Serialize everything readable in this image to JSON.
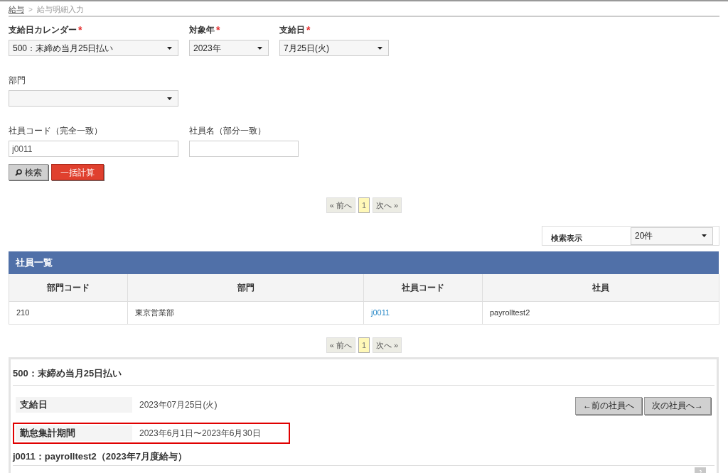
{
  "breadcrumb": {
    "items": [
      {
        "label": "給与",
        "kind": "link"
      },
      {
        "label": "給与明細入力",
        "kind": "current"
      }
    ],
    "separator": ">"
  },
  "filter_rows": [
    {
      "fields": [
        {
          "label": "支給日カレンダー",
          "required_mark": "*",
          "kind": "select",
          "value": "500：末締め当月25日払い"
        },
        {
          "label": "対象年",
          "required_mark": "*",
          "kind": "select",
          "value": "2023年"
        },
        {
          "label": "支給日",
          "required_mark": "*",
          "kind": "select",
          "value": "7月25日(火)"
        }
      ]
    },
    {
      "fields": [
        {
          "label": "部門",
          "kind": "select"
        }
      ]
    },
    {
      "fields": [
        {
          "label": "社員コード（完全一致）",
          "kind": "input",
          "value": "j0011"
        },
        {
          "label": "社員名（部分一致）",
          "kind": "input"
        }
      ]
    }
  ],
  "actions": [
    {
      "label": "検索",
      "kind": "search"
    },
    {
      "label": "一括計算",
      "kind": "danger"
    }
  ],
  "pagination_top": {
    "prev": "« 前へ",
    "pages": [
      {
        "label": "1",
        "selected": true
      }
    ],
    "next": "次へ »"
  },
  "page_size": {
    "label": "検索表示",
    "value": "20件"
  },
  "table": {
    "title": "社員一覧",
    "columns": [
      "部門コード",
      "部門",
      "社員コード",
      "社員"
    ],
    "rows": [
      {
        "cells": [
          {
            "text": "210",
            "kind": "text"
          },
          {
            "text": "東京営業部",
            "kind": "text"
          },
          {
            "text": "j0011",
            "kind": "link"
          },
          {
            "text": "payrolltest2",
            "kind": "text"
          }
        ]
      }
    ]
  },
  "pagination_bottom": {
    "prev": "« 前へ",
    "pages": [
      {
        "label": "1",
        "selected": true
      }
    ],
    "next": "次へ »"
  },
  "detail": {
    "title": "500：末締め当月25日払い",
    "info_rows": [
      {
        "label": "支給日",
        "value": "2023年07月25日(火)",
        "highlighted": false
      },
      {
        "label": "勤怠集計期間",
        "value": "2023年6月1日〜2023年6月30日",
        "highlighted": true
      }
    ],
    "nav_buttons": [
      "←前の社員へ",
      "次の社員へ→"
    ],
    "employee_heading": "j0011：payrolltest2（2023年7月度給与）"
  }
}
